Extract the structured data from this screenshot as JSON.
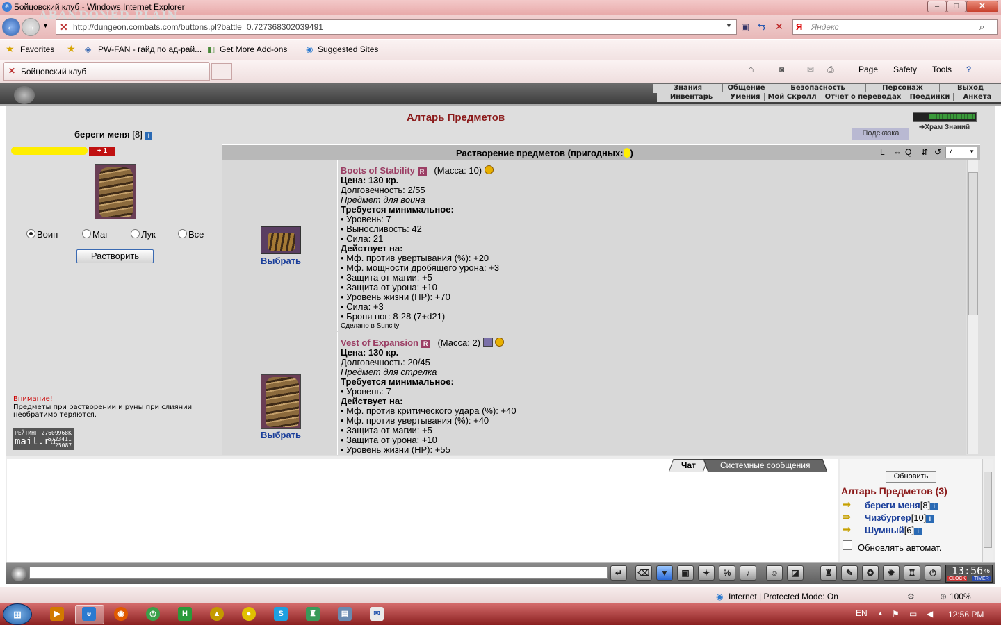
{
  "window": {
    "title": "Бойцовский клуб - Windows Internet Explorer"
  },
  "browser": {
    "url": "http://dungeon.combats.com/buttons.pl?battle=0.727368302039491",
    "search_placeholder": "Яндекс",
    "favorites": [
      "Favorites",
      "PW-FAN - гайд по ад-рай...",
      "Get More Add-ons",
      "Suggested Sites"
    ],
    "tab_title": "Бойцовский клуб",
    "tools": [
      "Page",
      "Safety",
      "Tools"
    ]
  },
  "game": {
    "logo": "ABANDONED PLAIN",
    "menu_top": [
      "Знания",
      "Общение",
      "Безопасность",
      "Персонаж",
      "Выход"
    ],
    "menu_bottom": [
      "Инвентарь",
      "Умения",
      "Мой Скролл",
      "Отчет о переводах",
      "Поединки",
      "Анкета"
    ],
    "page_title": "Алтарь Предметов",
    "hint_button": "Подсказка",
    "hram_link": "Храм Знаний",
    "character": {
      "name": "береги меня",
      "level": "[8]",
      "plus": "+ 1"
    },
    "class_options": [
      "Воин",
      "Маг",
      "Лук",
      "Все"
    ],
    "selected_class": "Воин",
    "dissolve_button": "Растворить",
    "warning_title": "Внимание!",
    "warning_text": "Предметы при растворении и руны при слиянии необратимо теряются.",
    "rating": {
      "label": "РЕЙТИНГ",
      "num1": "27609968K",
      "num2": "5723411",
      "num3": "25087",
      "brand": "mail.ru"
    },
    "panel": {
      "title": "Растворение предметов (пригодных:",
      "title_end": ")",
      "icons": [
        "L",
        "⇔",
        "Q",
        "⇵",
        "↺"
      ],
      "select_value": "7"
    },
    "pick_label": "Выбрать",
    "items": [
      {
        "name": "Boots of Stability",
        "badge": "R",
        "mass": "(Масса: 10)",
        "price": "Цена: 130 кр.",
        "durability": "Долговечность: 2/55",
        "for_class": "Предмет для воина",
        "req_title": "Требуется минимальное:",
        "reqs": [
          "• Уровень: 7",
          "• Выносливость: 42",
          "• Сила: 21"
        ],
        "acts_title": "Действует на:",
        "acts": [
          "• Мф. против увертывания (%): +20",
          "• Мф. мощности дробящего урона: +3",
          "• Защита от магии: +5",
          "• Защита от урона: +10",
          "• Уровень жизни (HP): +70",
          "• Сила: +3",
          "• Броня ног: 8-28 (7+d21)"
        ],
        "made": "Сделано в Suncity"
      },
      {
        "name": "Vest of Expansion",
        "badge": "R",
        "mass": "(Масса: 2)",
        "price": "Цена: 130 кр.",
        "durability": "Долговечность: 20/45",
        "for_class": "Предмет для стрелка",
        "req_title": "Требуется минимальное:",
        "reqs": [
          "• Уровень: 7"
        ],
        "acts_title": "Действует на:",
        "acts": [
          "• Мф. против критического удара (%): +40",
          "• Мф. против увертывания (%): +40",
          "• Защита от магии: +5",
          "• Защита от урона: +10",
          "• Уровень жизни (HP): +55"
        ]
      }
    ],
    "chat": {
      "tabs": [
        "Чат",
        "Системные сообщения"
      ],
      "refresh_button": "Обновить",
      "room_title": "Алтарь Предметов (3)",
      "users": [
        {
          "name": "береги меня",
          "level": "[8]"
        },
        {
          "name": "Чизбургер",
          "level": "[10]"
        },
        {
          "name": "Шумный",
          "level": "[6]"
        }
      ],
      "auto_refresh_label": "Обновлять автомат."
    },
    "clock": {
      "time": "13:56",
      "seconds": "46",
      "label1": "CLOCK",
      "label2": "TIMER"
    }
  },
  "statusbar": {
    "zone": "Internet | Protected Mode: On",
    "zoom": "100%"
  },
  "taskbar": {
    "lang": "EN",
    "time": "12:56 PM"
  }
}
